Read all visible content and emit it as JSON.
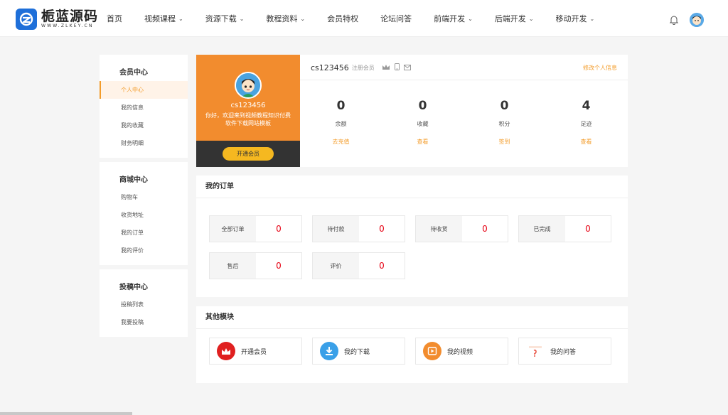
{
  "brand": {
    "name": "栀蓝源码",
    "sub": "WWW.ZLKEY.CN"
  },
  "nav": [
    {
      "label": "首页",
      "dropdown": false
    },
    {
      "label": "视频课程",
      "dropdown": true
    },
    {
      "label": "资源下载",
      "dropdown": true
    },
    {
      "label": "教程资料",
      "dropdown": true
    },
    {
      "label": "会员特权",
      "dropdown": false
    },
    {
      "label": "论坛问答",
      "dropdown": false
    },
    {
      "label": "前端开发",
      "dropdown": true
    },
    {
      "label": "后端开发",
      "dropdown": true
    },
    {
      "label": "移动开发",
      "dropdown": true
    }
  ],
  "sidebar": {
    "groups": [
      {
        "title": "会员中心",
        "items": [
          "个人中心",
          "我的信息",
          "我的收藏",
          "财务明细"
        ]
      },
      {
        "title": "商城中心",
        "items": [
          "购物车",
          "收货地址",
          "我的订单",
          "我的评价"
        ]
      },
      {
        "title": "投稿中心",
        "items": [
          "投稿列表",
          "我要投稿"
        ]
      }
    ],
    "active": "个人中心"
  },
  "profile": {
    "username": "cs123456",
    "greeting": "你好，欢迎来到视频教程知识付费软件下载网站模板",
    "vip_button": "开通会员",
    "role": "注册会员",
    "edit_link": "修改个人信息",
    "stats": [
      {
        "value": "0",
        "label": "余额",
        "link": "去充值"
      },
      {
        "value": "0",
        "label": "收藏",
        "link": "查看"
      },
      {
        "value": "0",
        "label": "积分",
        "link": "签到"
      },
      {
        "value": "4",
        "label": "足迹",
        "link": "查看"
      }
    ]
  },
  "orders": {
    "title": "我的订单",
    "items": [
      {
        "label": "全部订单",
        "count": "0"
      },
      {
        "label": "待付款",
        "count": "0"
      },
      {
        "label": "待收货",
        "count": "0"
      },
      {
        "label": "已完成",
        "count": "0"
      },
      {
        "label": "售后",
        "count": "0"
      },
      {
        "label": "评价",
        "count": "0"
      }
    ]
  },
  "modules": {
    "title": "其他模块",
    "items": [
      {
        "label": "开通会员",
        "icon": "crown-icon",
        "color": "#e02020"
      },
      {
        "label": "我的下载",
        "icon": "download-icon",
        "color": "#3aa0e8"
      },
      {
        "label": "我的视频",
        "icon": "play-icon",
        "color": "#f28c2e"
      },
      {
        "label": "我的问答",
        "icon": "qa-icon",
        "color": "#e84c3d"
      }
    ]
  },
  "colors": {
    "accent": "#f39c2a",
    "profile_bg": "#f28c2e",
    "count": "#e60012",
    "brand": "#1e6fd9"
  }
}
